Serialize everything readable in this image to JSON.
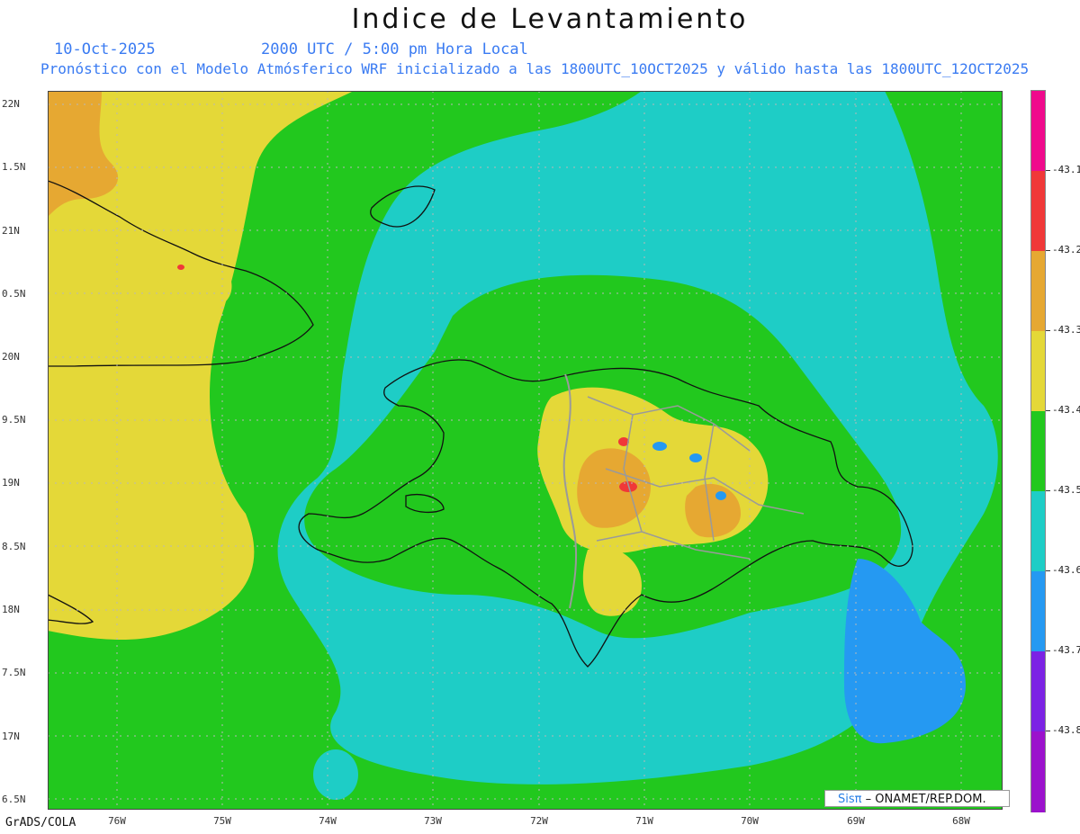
{
  "title": "Indice de Levantamiento",
  "date": "10-Oct-2025",
  "time": "2000 UTC / 5:00 pm Hora Local",
  "forecast": "Pronóstico con el Modelo Atmósferico WRF inicializado a las 1800UTC_10OCT2025 y válido hasta las  1800UTC_12OCT2025",
  "footer": "GrADS/COLA",
  "credit": {
    "sis": "Sisπ",
    "rest": "– ONAMET/REP.DOM."
  },
  "lat_labels": [
    "22N",
    "1.5N",
    "21N",
    "0.5N",
    "20N",
    "9.5N",
    "19N",
    "8.5N",
    "18N",
    "7.5N",
    "17N",
    "6.5N"
  ],
  "lon_labels": [
    "76W",
    "75W",
    "74W",
    "73W",
    "72W",
    "71W",
    "70W",
    "69W",
    "68W"
  ],
  "colorbar": {
    "colors": [
      "#ef0a8c",
      "#f03838",
      "#e6a832",
      "#e4d838",
      "#22c81e",
      "#1ecdc6",
      "#2599f2",
      "#7c22e4",
      "#9b12cc"
    ],
    "labels": [
      "-43.1",
      "-43.2",
      "-43.3",
      "-43.4",
      "-43.5",
      "-43.6",
      "-43.7",
      "-43.8"
    ]
  },
  "palette": {
    "ocean_green": "#22c81e",
    "yellow": "#e4d838",
    "orange": "#e6a832",
    "cyan": "#1ecdc6",
    "blue": "#2599f2",
    "red": "#f03838"
  }
}
